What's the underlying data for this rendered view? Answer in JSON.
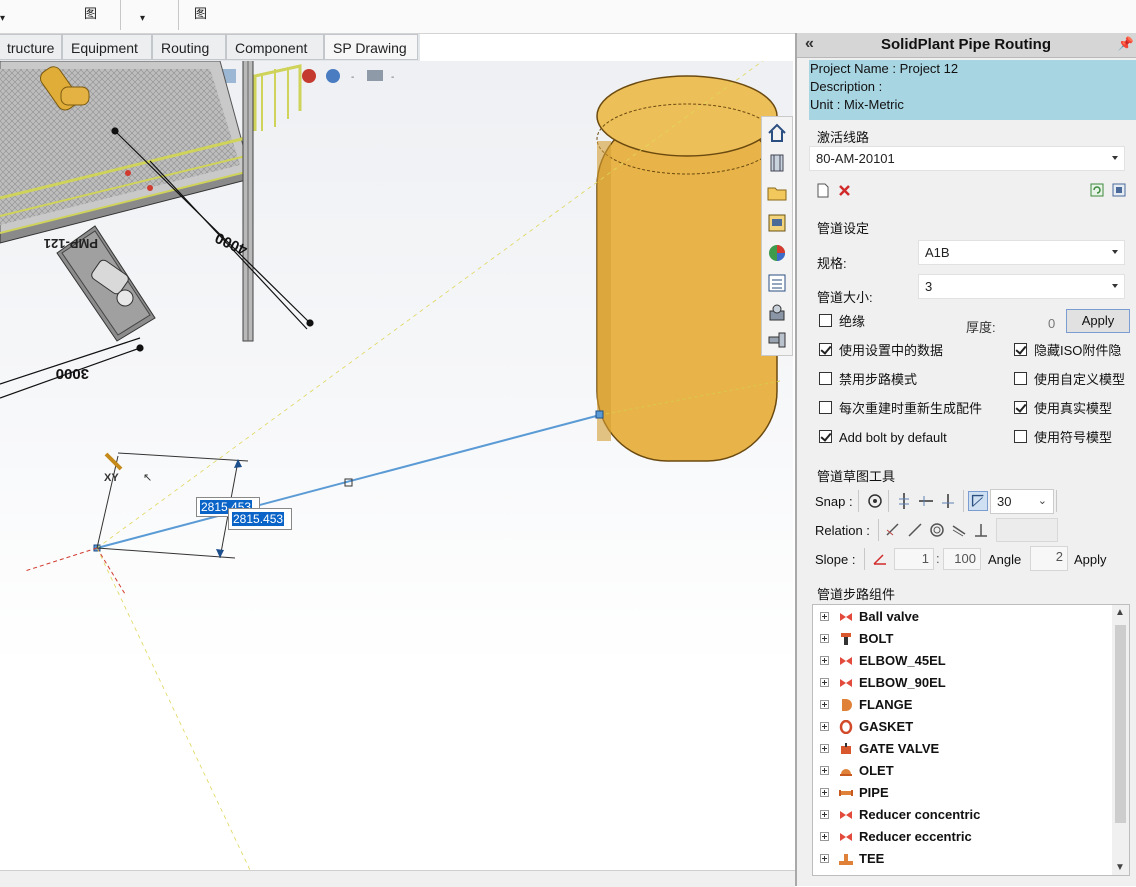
{
  "ribbon": {
    "label_a": "图",
    "label_b": "图"
  },
  "tabs": [
    {
      "label": "tructure"
    },
    {
      "label": "Equipment"
    },
    {
      "label": "Routing"
    },
    {
      "label": "Component"
    },
    {
      "label": "SP Drawing"
    }
  ],
  "viewport": {
    "dim_input_back": "2815.453",
    "dim_input_front": "2815.453",
    "dim_4000": "4000",
    "dim_3000": "3000",
    "pump_tag": "PMP-121",
    "axis_label": "XY"
  },
  "panel": {
    "title": "SolidPlant Pipe Routing",
    "project_name": "Project Name : Project 12",
    "description": "Description :",
    "unit": "Unit : Mix-Metric",
    "active_route_label": "激活线路",
    "active_route_value": "80-AM-20101",
    "pipe_settings_label": "管道设定",
    "spec_label": "规格:",
    "spec_value": "A1B",
    "size_label": "管道大小:",
    "size_value": "3",
    "insulation_label": "绝缘",
    "thickness_label": "厚度:",
    "thickness_value": "0",
    "apply_label": "Apply",
    "options": [
      {
        "label": "使用设置中的数据",
        "checked": true
      },
      {
        "label": "隐藏ISO附件隐",
        "checked": true
      },
      {
        "label": "禁用步路模式",
        "checked": false
      },
      {
        "label": "使用自定义模型",
        "checked": false
      },
      {
        "label": "每次重建时重新生成配件",
        "checked": false
      },
      {
        "label": "使用真实模型",
        "checked": true
      },
      {
        "label": "Add bolt by default",
        "checked": true
      },
      {
        "label": "使用符号模型",
        "checked": false
      }
    ],
    "sketch_tools_label": "管道草图工具",
    "snap_label": "Snap :",
    "snap_angle": "30",
    "relation_label": "Relation :",
    "slope_label": "Slope :",
    "slope_rise": "1",
    "slope_colon": ":",
    "slope_run": "100",
    "angle_label": "Angle",
    "angle_value": "2",
    "slope_apply_label": "Apply",
    "components_label": "管道步路组件",
    "components": [
      {
        "label": "Ball valve",
        "icon": "valve-icon"
      },
      {
        "label": "BOLT",
        "icon": "bolt-icon"
      },
      {
        "label": "ELBOW_45EL",
        "icon": "elbow-icon"
      },
      {
        "label": "ELBOW_90EL",
        "icon": "elbow-icon"
      },
      {
        "label": "FLANGE",
        "icon": "flange-icon"
      },
      {
        "label": "GASKET",
        "icon": "gasket-icon"
      },
      {
        "label": "GATE VALVE",
        "icon": "gate-valve-icon"
      },
      {
        "label": "OLET",
        "icon": "olet-icon"
      },
      {
        "label": "PIPE",
        "icon": "pipe-icon"
      },
      {
        "label": "Reducer concentric",
        "icon": "reducer-icon"
      },
      {
        "label": "Reducer eccentric",
        "icon": "reducer-icon"
      },
      {
        "label": "TEE",
        "icon": "tee-icon"
      }
    ]
  },
  "colors": {
    "project_box": "#a8d5e2",
    "vessel": "#e8b44a",
    "route_line": "#5b9bd5",
    "selection": "#0a64c8"
  }
}
